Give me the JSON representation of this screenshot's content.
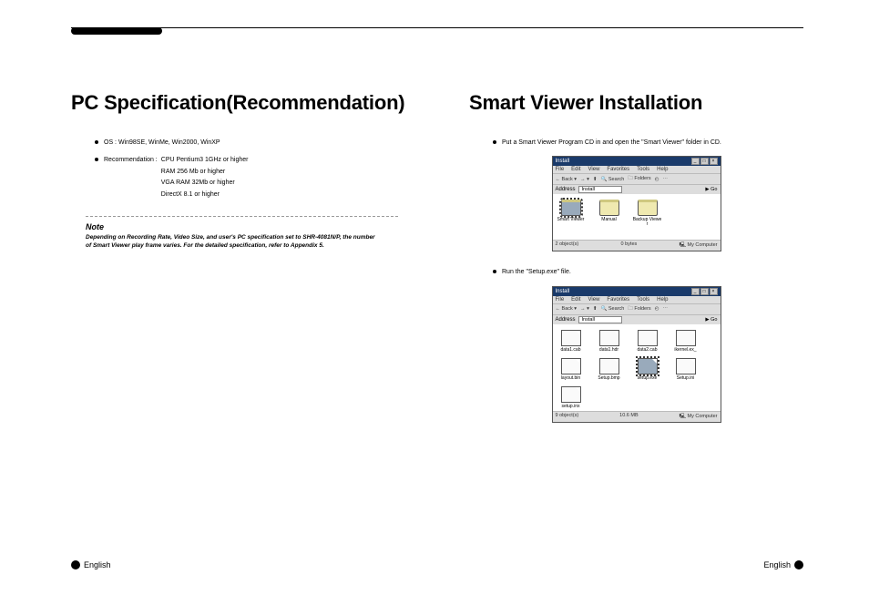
{
  "left": {
    "heading": "PC Specification(Recommendation)",
    "os_line": "OS : Win98SE, WinMe, Win2000, WinXP",
    "rec_label": "Recommendation :",
    "rec_lines": [
      "CPU Pentium3 1GHz or higher",
      "RAM 256 Mb or higher",
      "VGA RAM 32Mb or higher",
      "DirectX 8.1 or higher"
    ],
    "note_label": "Note",
    "note_text": "Depending on Recording Rate, Video Size, and user's PC specification set to SHR-4081N/P, the number of Smart Viewer play frame varies. For the detailed specification, refer to Appendix 5.",
    "footer": "English"
  },
  "right": {
    "heading": "Smart Viewer Installation",
    "step1": "Put a Smart Viewer Program CD in and open the \"Smart Viewer\" folder in CD.",
    "step2": "Run the \"Setup.exe\" file.",
    "footer": "English"
  },
  "win": {
    "title": "Install",
    "menus": [
      "File",
      "Edit",
      "View",
      "Favorites",
      "Tools",
      "Help"
    ],
    "back": "Back",
    "search": "Search",
    "folders": "Folders",
    "addr_label": "Address",
    "addr_value": "Install",
    "go": "Go",
    "status1": {
      "left": "2 object(s)",
      "mid": "0 bytes",
      "right": "My Computer"
    },
    "status2": {
      "left": "9 object(s)",
      "mid": "10.6 MB",
      "right": "My Computer"
    },
    "files1": [
      {
        "name": "Smart Viewer",
        "type": "folder",
        "sel": true
      },
      {
        "name": "Manual",
        "type": "folder"
      },
      {
        "name": "Backup Viewer",
        "type": "folder"
      }
    ],
    "files2": [
      {
        "name": "data1.cab",
        "type": "doc"
      },
      {
        "name": "data1.hdr",
        "type": "doc"
      },
      {
        "name": "data2.cab",
        "type": "doc"
      },
      {
        "name": "ikernel.ex_",
        "type": "doc"
      },
      {
        "name": "layout.bin",
        "type": "doc"
      },
      {
        "name": "Setup.bmp",
        "type": "doc"
      },
      {
        "name": "setup.exe",
        "type": "doc",
        "sel": true
      },
      {
        "name": "Setup.ini",
        "type": "doc"
      },
      {
        "name": "setup.inx",
        "type": "doc"
      }
    ]
  }
}
